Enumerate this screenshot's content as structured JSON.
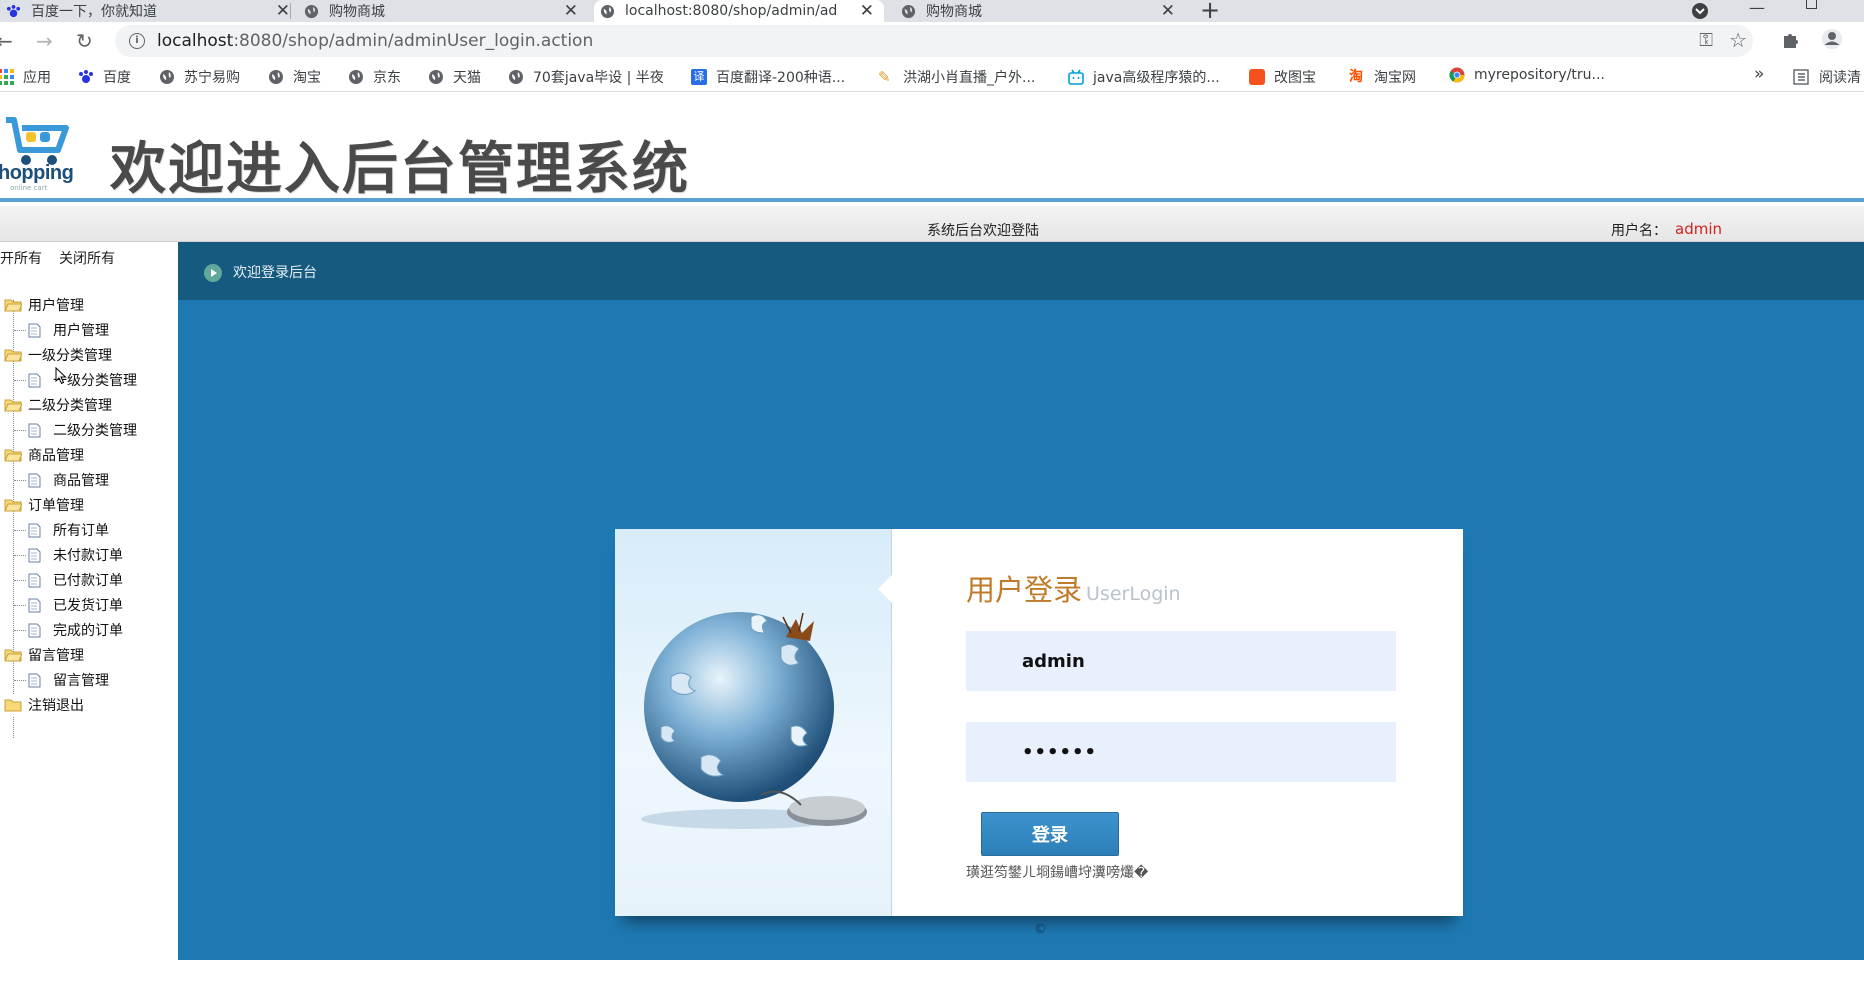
{
  "browser": {
    "tabs": [
      {
        "title": "百度一下，你就知道",
        "close": "✕"
      },
      {
        "title": "购物商城",
        "close": "✕"
      },
      {
        "title": "localhost:8080/shop/admin/ad",
        "close": "✕"
      },
      {
        "title": "购物商城",
        "close": "✕"
      }
    ],
    "new_tab": "+",
    "url_host": "localhost",
    "url_rest": ":8080/shop/admin/adminUser_login.action",
    "bookmarks": [
      {
        "label": "应用",
        "icon": "apps-grid-icon"
      },
      {
        "label": "百度",
        "icon": "baidu-icon"
      },
      {
        "label": "苏宁易购",
        "icon": "globe-icon"
      },
      {
        "label": "淘宝",
        "icon": "globe-icon"
      },
      {
        "label": "京东",
        "icon": "globe-icon"
      },
      {
        "label": "天猫",
        "icon": "globe-icon"
      },
      {
        "label": "70套java毕设 | 半夜",
        "icon": "globe-icon"
      },
      {
        "label": "百度翻译-200种语...",
        "icon": "translate-icon"
      },
      {
        "label": "洪湖小肖直播_户外...",
        "icon": "feather-icon"
      },
      {
        "label": "java高级程序猿的...",
        "icon": "bilibili-icon"
      },
      {
        "label": "改图宝",
        "icon": "gaitubao-icon"
      },
      {
        "label": "淘宝网",
        "icon": "taobao-icon"
      },
      {
        "label": "myrepository/tru...",
        "icon": "chrome-icon"
      }
    ],
    "bookmarks_more": "»",
    "reading_list": "阅读清"
  },
  "header": {
    "logo_text": "hopping",
    "logo_sub": "online cart",
    "title": "欢迎进入后台管理系统"
  },
  "status": {
    "welcome": "系统后台欢迎登陆",
    "username_label": "用户名：",
    "username": "admin"
  },
  "sidebar": {
    "expand_all": "开所有",
    "collapse_all": "关闭所有",
    "groups": [
      {
        "label": "用户管理",
        "items": [
          "用户管理"
        ]
      },
      {
        "label": "一级分类管理",
        "items": [
          "一级分类管理"
        ]
      },
      {
        "label": "二级分类管理",
        "items": [
          "二级分类管理"
        ]
      },
      {
        "label": "商品管理",
        "items": [
          "商品管理"
        ]
      },
      {
        "label": "订单管理",
        "items": [
          "所有订单",
          "未付款订单",
          "已付款订单",
          "已发货订单",
          "完成的订单"
        ]
      },
      {
        "label": "留言管理",
        "items": [
          "留言管理"
        ]
      },
      {
        "label": "注销退出",
        "items": []
      }
    ]
  },
  "main": {
    "breadcrumb": "欢迎登录后台",
    "login": {
      "title": "用户登录",
      "title_en": "UserLogin",
      "username_value": "admin",
      "password_value": "••••••",
      "submit": "登录",
      "error": "璜逛笉鐢ㄦ埛鍚嶆垨瀵嗙爜�"
    },
    "copyright": "©"
  },
  "colors": {
    "content_bg": "#1e79b3",
    "content_head": "#165a80",
    "title_orange": "#c07a2a",
    "username_red": "#d4201e"
  }
}
